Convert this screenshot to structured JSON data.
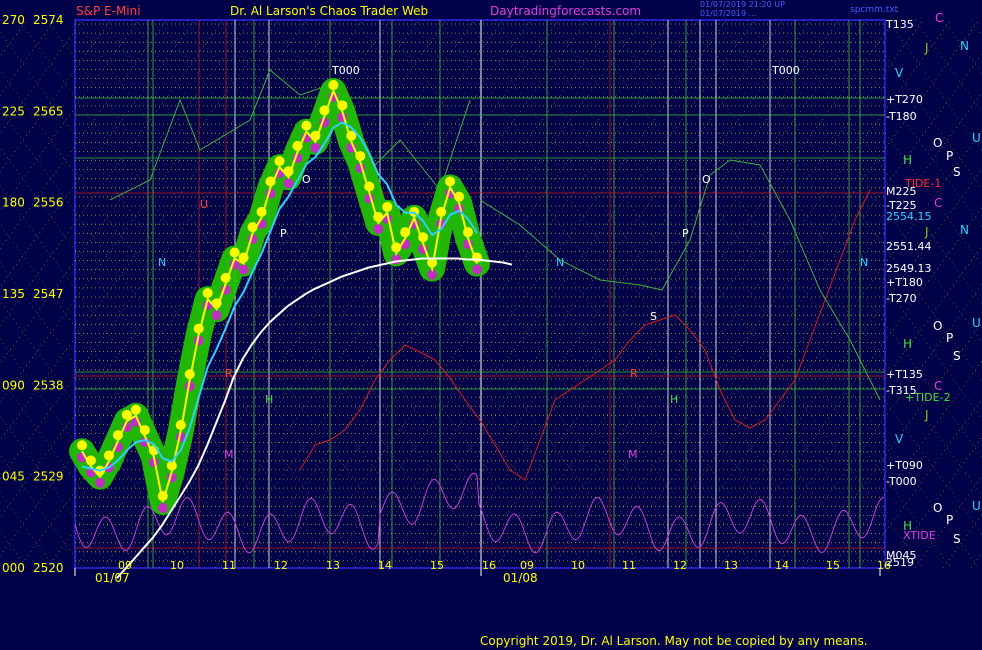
{
  "header": {
    "title_instrument": "S&P E-Mini",
    "title_main": "Dr. Al Larson's Chaos Trader Web",
    "site": "Daytradingforecasts.com",
    "timestamp_1": "01/07/2019 21:20 UP",
    "timestamp_2": "01/07/2019 ...",
    "top_right": "spcmm.txt"
  },
  "footer": {
    "copyright": "Copyright 2019, Dr. Al Larson. May not be copied by any means."
  },
  "colors": {
    "background": "#000048",
    "price_band": "#22c000",
    "price_line": "#ffff00",
    "ema_fast": "#30d0ff",
    "ema_slow": "#ffffff",
    "tide": "#d02020",
    "xtide": "#c040d0",
    "grid_dotted": "#d0d040",
    "planet_line": "#20c040",
    "right_scale": "#ffffff"
  },
  "chart_data": {
    "type": "line",
    "title": "S&P E-Mini",
    "ylabel": "",
    "ylim": [
      2520,
      2574
    ],
    "y_ticks_price": [
      2520,
      2529,
      2538,
      2547,
      2556,
      2565,
      2574
    ],
    "y_ticks_angle": [
      "000",
      "045",
      "090",
      "135",
      "180",
      "225",
      "270"
    ],
    "x_date_labels": [
      "01/07",
      "01/08"
    ],
    "x_hour_labels_day1": [
      "09",
      "10",
      "11",
      "12",
      "13",
      "14",
      "15",
      "16"
    ],
    "x_hour_labels_day2": [
      "09",
      "10",
      "11",
      "12",
      "13",
      "14",
      "15",
      "16"
    ],
    "price_series": {
      "name": "price",
      "x": [
        0,
        0.2,
        0.4,
        0.6,
        0.8,
        1.0,
        1.2,
        1.4,
        1.6,
        1.8,
        2.0,
        2.2,
        2.4,
        2.6,
        2.8,
        3.0,
        3.2,
        3.4,
        3.6,
        3.8,
        4.0,
        4.2,
        4.4,
        4.6,
        4.8,
        5.0,
        5.2,
        5.4,
        5.6,
        5.8,
        6.0,
        6.2,
        6.4,
        6.6,
        6.8,
        7.0,
        7.2,
        7.4,
        7.6,
        7.8,
        8.0,
        8.2,
        8.4,
        8.6,
        8.8,
        9.0,
        9.2,
        9.4,
        9.6,
        9.8,
        10.0,
        10.2,
        10.4,
        10.6,
        10.8,
        11.0,
        11.2,
        11.4,
        11.6,
        11.8,
        12.0,
        12.2,
        12.4,
        12.6,
        12.8,
        13.0,
        13.2,
        13.4,
        13.6,
        13.8,
        14.0
      ],
      "values": [
        2531.5,
        2530.0,
        2529.0,
        2530.5,
        2532.5,
        2534.5,
        2535.0,
        2533.0,
        2531.0,
        2526.5,
        2529.5,
        2533.5,
        2538.5,
        2543.0,
        2546.5,
        2545.5,
        2548.0,
        2550.5,
        2550.0,
        2553.0,
        2554.5,
        2557.5,
        2559.5,
        2558.5,
        2561.0,
        2563.0,
        2562.0,
        2564.5,
        2567.0,
        2565.0,
        2562.0,
        2560.0,
        2557.0,
        2554.0,
        2555.0,
        2551.0,
        2552.5,
        2554.5,
        2552.0,
        2549.5,
        2554.5,
        2557.5,
        2556.0,
        2552.5,
        2550.0
      ],
      "x_end_note": "price series covers first session only"
    },
    "ema_fast": {
      "name": "ema-fast",
      "values": [
        2530.0,
        2529.8,
        2529.6,
        2529.9,
        2530.6,
        2531.6,
        2532.4,
        2532.6,
        2532.2,
        2530.8,
        2530.5,
        2531.6,
        2533.8,
        2536.8,
        2539.8,
        2541.6,
        2543.6,
        2545.8,
        2547.2,
        2549.2,
        2551.0,
        2553.2,
        2555.4,
        2556.6,
        2558.2,
        2559.8,
        2560.5,
        2561.8,
        2563.4,
        2563.9,
        2563.4,
        2562.4,
        2560.8,
        2558.8,
        2557.8,
        2555.8,
        2555.0,
        2555.0,
        2554.2,
        2552.8,
        2553.4,
        2554.8,
        2555.2,
        2554.4,
        2553.0
      ]
    },
    "ema_slow": {
      "name": "ema-slow",
      "values": [
        2519.0,
        2520.0,
        2521.0,
        2522.0,
        2523.0,
        2524.2,
        2525.6,
        2527.0,
        2528.4,
        2530.0,
        2532.0,
        2534.2,
        2536.4,
        2538.8,
        2540.6,
        2542.0,
        2543.2,
        2544.2,
        2545.0,
        2545.8,
        2546.4,
        2547.0,
        2547.5,
        2547.9,
        2548.3,
        2548.7,
        2549.0,
        2549.3,
        2549.6,
        2549.8,
        2550.0,
        2550.2,
        2550.3,
        2550.4,
        2550.5,
        2550.5,
        2550.5,
        2550.5,
        2550.5,
        2550.4,
        2550.4,
        2550.3,
        2550.2,
        2550.1,
        2549.9
      ]
    },
    "right_labels": [
      {
        "text": "T135",
        "color": "#ffffff"
      },
      {
        "text": "+T270",
        "color": "#ffffff"
      },
      {
        "text": "-T180",
        "color": "#ffffff"
      },
      {
        "text": "TIDE-1",
        "color": "#ff3030"
      },
      {
        "text": "M225",
        "color": "#ffffff"
      },
      {
        "text": "-T225",
        "color": "#ffffff"
      },
      {
        "text": "2554.15",
        "color": "#30d0ff"
      },
      {
        "text": "2551.44",
        "color": "#ffffff"
      },
      {
        "text": "2549.13",
        "color": "#ffffff"
      },
      {
        "text": "+T180",
        "color": "#ffffff"
      },
      {
        "text": "-T270",
        "color": "#ffffff"
      },
      {
        "text": "+T135",
        "color": "#ffffff"
      },
      {
        "text": "-T315",
        "color": "#ffffff"
      },
      {
        "text": "+TIDE-2",
        "color": "#40e040"
      },
      {
        "text": "+T090",
        "color": "#ffffff"
      },
      {
        "text": "-T000",
        "color": "#ffffff"
      },
      {
        "text": "XTIDE",
        "color": "#e040e0"
      },
      {
        "text": "M045",
        "color": "#ffffff"
      },
      {
        "text": "2519",
        "color": "#ffffff"
      }
    ],
    "planet_glyphs": [
      "C",
      "N",
      "J",
      "V",
      "U",
      "O",
      "P",
      "H",
      "S"
    ],
    "chart_annotations": [
      "T000",
      "T000",
      "N",
      "N",
      "N",
      "N",
      "O",
      "P",
      "H",
      "M",
      "S",
      "C",
      "U"
    ]
  }
}
